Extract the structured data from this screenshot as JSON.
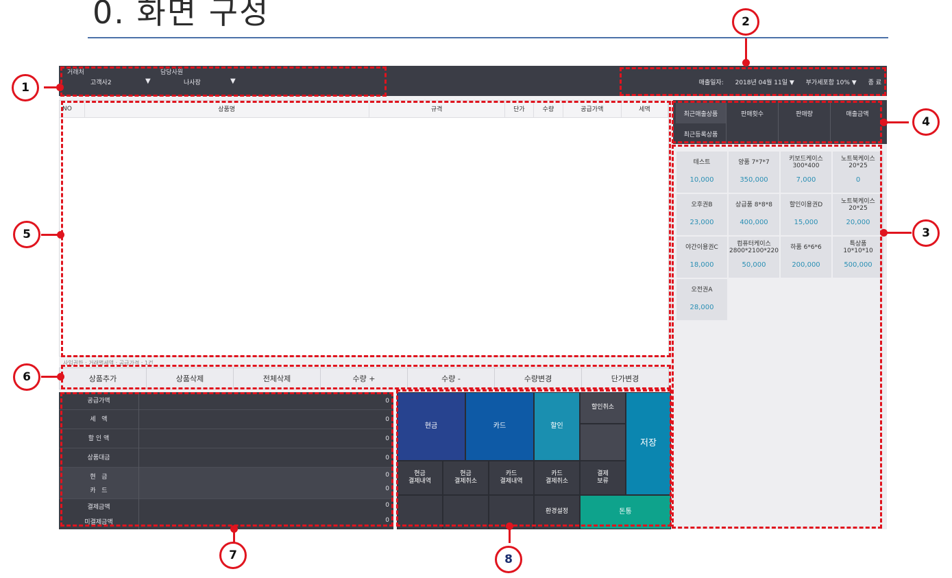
{
  "slide": {
    "title": "0. 화면 구성"
  },
  "topbar": {
    "customer_label": "거래처",
    "customer_value": "고객사2",
    "staff_label": "담당사원",
    "staff_value": "나사장",
    "date_label": "매출일자:",
    "date_value": "2018년 04월 11일 ▼",
    "vat_value": "부가세포함 10% ▼",
    "exit_label": "종 료",
    "arrow": "▼"
  },
  "grid": {
    "columns": [
      "NO",
      "상품명",
      "규격",
      "단가",
      "수량",
      "공급가액",
      "세액"
    ],
    "note": "사입권한 : 거래별세액 : 공급가격 : 1건"
  },
  "actions": [
    "상품추가",
    "상품삭제",
    "전체삭제",
    "수량 +",
    "수량 -",
    "수량변경",
    "단가변경"
  ],
  "totals": [
    {
      "label": "공급가액",
      "value": "0"
    },
    {
      "label": "세   액",
      "value": "0"
    },
    {
      "label": "할 인 액",
      "value": "0"
    },
    {
      "label": "상품대금",
      "value": "0"
    },
    {
      "label": "현   금",
      "value": "0"
    },
    {
      "label": "카   드",
      "value": "0"
    },
    {
      "label": "결제금액",
      "value": "0"
    },
    {
      "label": "미결제금액",
      "value": "0"
    }
  ],
  "pad": {
    "cash": "현금",
    "card": "카드",
    "discount": "할인",
    "discount_cancel": "할인취소",
    "save": "저장",
    "cash_history": "현금\n결제내역",
    "cash_cancel": "현금\n결제취소",
    "card_history": "카드\n결제내역",
    "card_cancel": "카드\n결제취소",
    "hold": "결제\n보류",
    "settings": "환경설정",
    "drawer": "돈통",
    "colors": {
      "cash": "#27438f",
      "card": "#0e5aa6",
      "discount": "#1a8fb0",
      "save": "#0b86b0",
      "drawer": "#0ea38c",
      "dark": "#3a3c45",
      "mid": "#464852"
    }
  },
  "rpanel": {
    "tabs": [
      "최근매출상품",
      "판매횟수",
      "판매량",
      "매출금액"
    ],
    "tab2": "최근등록상품",
    "products": [
      {
        "name": "테스트",
        "price": "10,000"
      },
      {
        "name": "양품 7*7*7",
        "price": "350,000"
      },
      {
        "name": "키보드케이스 300*400",
        "price": "7,000"
      },
      {
        "name": "노트북케이스 20*25",
        "price": "0"
      },
      {
        "name": "오후권B",
        "price": "23,000"
      },
      {
        "name": "상급품 8*8*8",
        "price": "400,000"
      },
      {
        "name": "할인이용권D",
        "price": "15,000"
      },
      {
        "name": "노트북케이스 20*25",
        "price": "20,000"
      },
      {
        "name": "야간이용권C",
        "price": "18,000"
      },
      {
        "name": "컴퓨터케이스 2800*2100*220",
        "price": "50,000"
      },
      {
        "name": "하품 6*6*6",
        "price": "200,000"
      },
      {
        "name": "특상품 10*10*10",
        "price": "500,000"
      },
      {
        "name": "오전권A",
        "price": "28,000"
      }
    ]
  },
  "callouts": [
    "1",
    "2",
    "3",
    "4",
    "5",
    "6",
    "7",
    "8"
  ]
}
